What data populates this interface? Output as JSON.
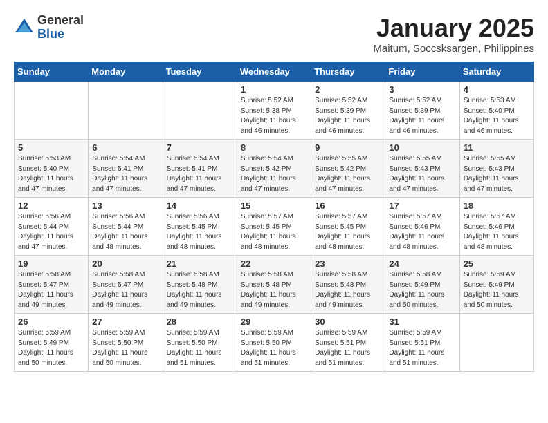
{
  "header": {
    "logo_general": "General",
    "logo_blue": "Blue",
    "month_title": "January 2025",
    "location": "Maitum, Soccsksargen, Philippines"
  },
  "weekdays": [
    "Sunday",
    "Monday",
    "Tuesday",
    "Wednesday",
    "Thursday",
    "Friday",
    "Saturday"
  ],
  "weeks": [
    [
      {
        "day": "",
        "info": ""
      },
      {
        "day": "",
        "info": ""
      },
      {
        "day": "",
        "info": ""
      },
      {
        "day": "1",
        "info": "Sunrise: 5:52 AM\nSunset: 5:38 PM\nDaylight: 11 hours\nand 46 minutes."
      },
      {
        "day": "2",
        "info": "Sunrise: 5:52 AM\nSunset: 5:39 PM\nDaylight: 11 hours\nand 46 minutes."
      },
      {
        "day": "3",
        "info": "Sunrise: 5:52 AM\nSunset: 5:39 PM\nDaylight: 11 hours\nand 46 minutes."
      },
      {
        "day": "4",
        "info": "Sunrise: 5:53 AM\nSunset: 5:40 PM\nDaylight: 11 hours\nand 46 minutes."
      }
    ],
    [
      {
        "day": "5",
        "info": "Sunrise: 5:53 AM\nSunset: 5:40 PM\nDaylight: 11 hours\nand 47 minutes."
      },
      {
        "day": "6",
        "info": "Sunrise: 5:54 AM\nSunset: 5:41 PM\nDaylight: 11 hours\nand 47 minutes."
      },
      {
        "day": "7",
        "info": "Sunrise: 5:54 AM\nSunset: 5:41 PM\nDaylight: 11 hours\nand 47 minutes."
      },
      {
        "day": "8",
        "info": "Sunrise: 5:54 AM\nSunset: 5:42 PM\nDaylight: 11 hours\nand 47 minutes."
      },
      {
        "day": "9",
        "info": "Sunrise: 5:55 AM\nSunset: 5:42 PM\nDaylight: 11 hours\nand 47 minutes."
      },
      {
        "day": "10",
        "info": "Sunrise: 5:55 AM\nSunset: 5:43 PM\nDaylight: 11 hours\nand 47 minutes."
      },
      {
        "day": "11",
        "info": "Sunrise: 5:55 AM\nSunset: 5:43 PM\nDaylight: 11 hours\nand 47 minutes."
      }
    ],
    [
      {
        "day": "12",
        "info": "Sunrise: 5:56 AM\nSunset: 5:44 PM\nDaylight: 11 hours\nand 47 minutes."
      },
      {
        "day": "13",
        "info": "Sunrise: 5:56 AM\nSunset: 5:44 PM\nDaylight: 11 hours\nand 48 minutes."
      },
      {
        "day": "14",
        "info": "Sunrise: 5:56 AM\nSunset: 5:45 PM\nDaylight: 11 hours\nand 48 minutes."
      },
      {
        "day": "15",
        "info": "Sunrise: 5:57 AM\nSunset: 5:45 PM\nDaylight: 11 hours\nand 48 minutes."
      },
      {
        "day": "16",
        "info": "Sunrise: 5:57 AM\nSunset: 5:45 PM\nDaylight: 11 hours\nand 48 minutes."
      },
      {
        "day": "17",
        "info": "Sunrise: 5:57 AM\nSunset: 5:46 PM\nDaylight: 11 hours\nand 48 minutes."
      },
      {
        "day": "18",
        "info": "Sunrise: 5:57 AM\nSunset: 5:46 PM\nDaylight: 11 hours\nand 48 minutes."
      }
    ],
    [
      {
        "day": "19",
        "info": "Sunrise: 5:58 AM\nSunset: 5:47 PM\nDaylight: 11 hours\nand 49 minutes."
      },
      {
        "day": "20",
        "info": "Sunrise: 5:58 AM\nSunset: 5:47 PM\nDaylight: 11 hours\nand 49 minutes."
      },
      {
        "day": "21",
        "info": "Sunrise: 5:58 AM\nSunset: 5:48 PM\nDaylight: 11 hours\nand 49 minutes."
      },
      {
        "day": "22",
        "info": "Sunrise: 5:58 AM\nSunset: 5:48 PM\nDaylight: 11 hours\nand 49 minutes."
      },
      {
        "day": "23",
        "info": "Sunrise: 5:58 AM\nSunset: 5:48 PM\nDaylight: 11 hours\nand 49 minutes."
      },
      {
        "day": "24",
        "info": "Sunrise: 5:58 AM\nSunset: 5:49 PM\nDaylight: 11 hours\nand 50 minutes."
      },
      {
        "day": "25",
        "info": "Sunrise: 5:59 AM\nSunset: 5:49 PM\nDaylight: 11 hours\nand 50 minutes."
      }
    ],
    [
      {
        "day": "26",
        "info": "Sunrise: 5:59 AM\nSunset: 5:49 PM\nDaylight: 11 hours\nand 50 minutes."
      },
      {
        "day": "27",
        "info": "Sunrise: 5:59 AM\nSunset: 5:50 PM\nDaylight: 11 hours\nand 50 minutes."
      },
      {
        "day": "28",
        "info": "Sunrise: 5:59 AM\nSunset: 5:50 PM\nDaylight: 11 hours\nand 51 minutes."
      },
      {
        "day": "29",
        "info": "Sunrise: 5:59 AM\nSunset: 5:50 PM\nDaylight: 11 hours\nand 51 minutes."
      },
      {
        "day": "30",
        "info": "Sunrise: 5:59 AM\nSunset: 5:51 PM\nDaylight: 11 hours\nand 51 minutes."
      },
      {
        "day": "31",
        "info": "Sunrise: 5:59 AM\nSunset: 5:51 PM\nDaylight: 11 hours\nand 51 minutes."
      },
      {
        "day": "",
        "info": ""
      }
    ]
  ]
}
